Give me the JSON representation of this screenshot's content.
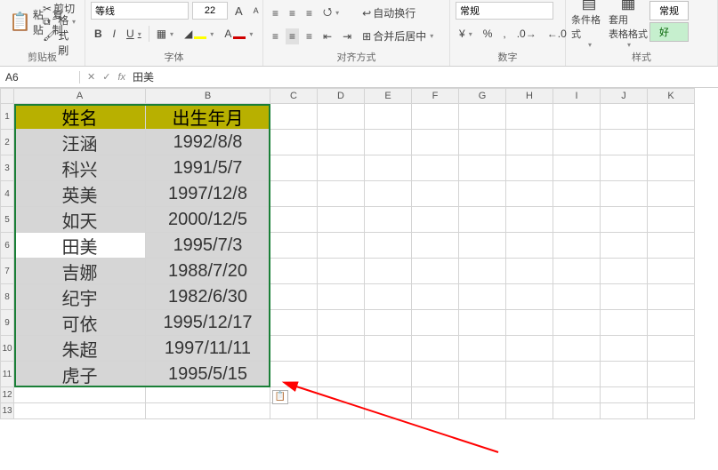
{
  "ribbon": {
    "clipboard": {
      "paste": "粘贴",
      "cut": "剪切",
      "copy": "复制",
      "format_painter": "格式刷",
      "label": "剪贴板"
    },
    "font": {
      "name": "等线",
      "size": "22",
      "inc": "A",
      "dec": "A",
      "bold": "B",
      "italic": "I",
      "underline": "U",
      "label": "字体"
    },
    "align": {
      "wrap": "自动换行",
      "merge": "合并后居中",
      "label": "对齐方式"
    },
    "number": {
      "general": "常规",
      "percent": "%",
      "comma": ",",
      "label": "数字"
    },
    "styles": {
      "cond": "条件格式",
      "table": "套用\n表格格式",
      "normal": "常规",
      "good": "好",
      "label": "样式"
    }
  },
  "namebox": {
    "ref": "A6",
    "fx": "fx",
    "value": "田美"
  },
  "columns": [
    "A",
    "B",
    "C",
    "D",
    "E",
    "F",
    "G",
    "H",
    "I",
    "J",
    "K"
  ],
  "headers": {
    "c1": "姓名",
    "c2": "出生年月"
  },
  "rows": [
    {
      "n": "汪涵",
      "d": "1992/8/8"
    },
    {
      "n": "科兴",
      "d": "1991/5/7"
    },
    {
      "n": "英美",
      "d": "1997/12/8"
    },
    {
      "n": "如天",
      "d": "2000/12/5"
    },
    {
      "n": "田美",
      "d": "1995/7/3"
    },
    {
      "n": "吉娜",
      "d": "1988/7/20"
    },
    {
      "n": "纪宇",
      "d": "1982/6/30"
    },
    {
      "n": "可依",
      "d": "1995/12/17"
    },
    {
      "n": "朱超",
      "d": "1997/11/11"
    },
    {
      "n": "虎子",
      "d": "1995/5/15"
    }
  ],
  "active_row_index": 4,
  "blank_rows": [
    12,
    13
  ],
  "chart_data": {
    "type": "table",
    "title": "",
    "columns": [
      "姓名",
      "出生年月"
    ],
    "rows": [
      [
        "汪涵",
        "1992/8/8"
      ],
      [
        "科兴",
        "1991/5/7"
      ],
      [
        "英美",
        "1997/12/8"
      ],
      [
        "如天",
        "2000/12/5"
      ],
      [
        "田美",
        "1995/7/3"
      ],
      [
        "吉娜",
        "1988/7/20"
      ],
      [
        "纪宇",
        "1982/6/30"
      ],
      [
        "可依",
        "1995/12/17"
      ],
      [
        "朱超",
        "1997/11/11"
      ],
      [
        "虎子",
        "1995/5/15"
      ]
    ]
  }
}
